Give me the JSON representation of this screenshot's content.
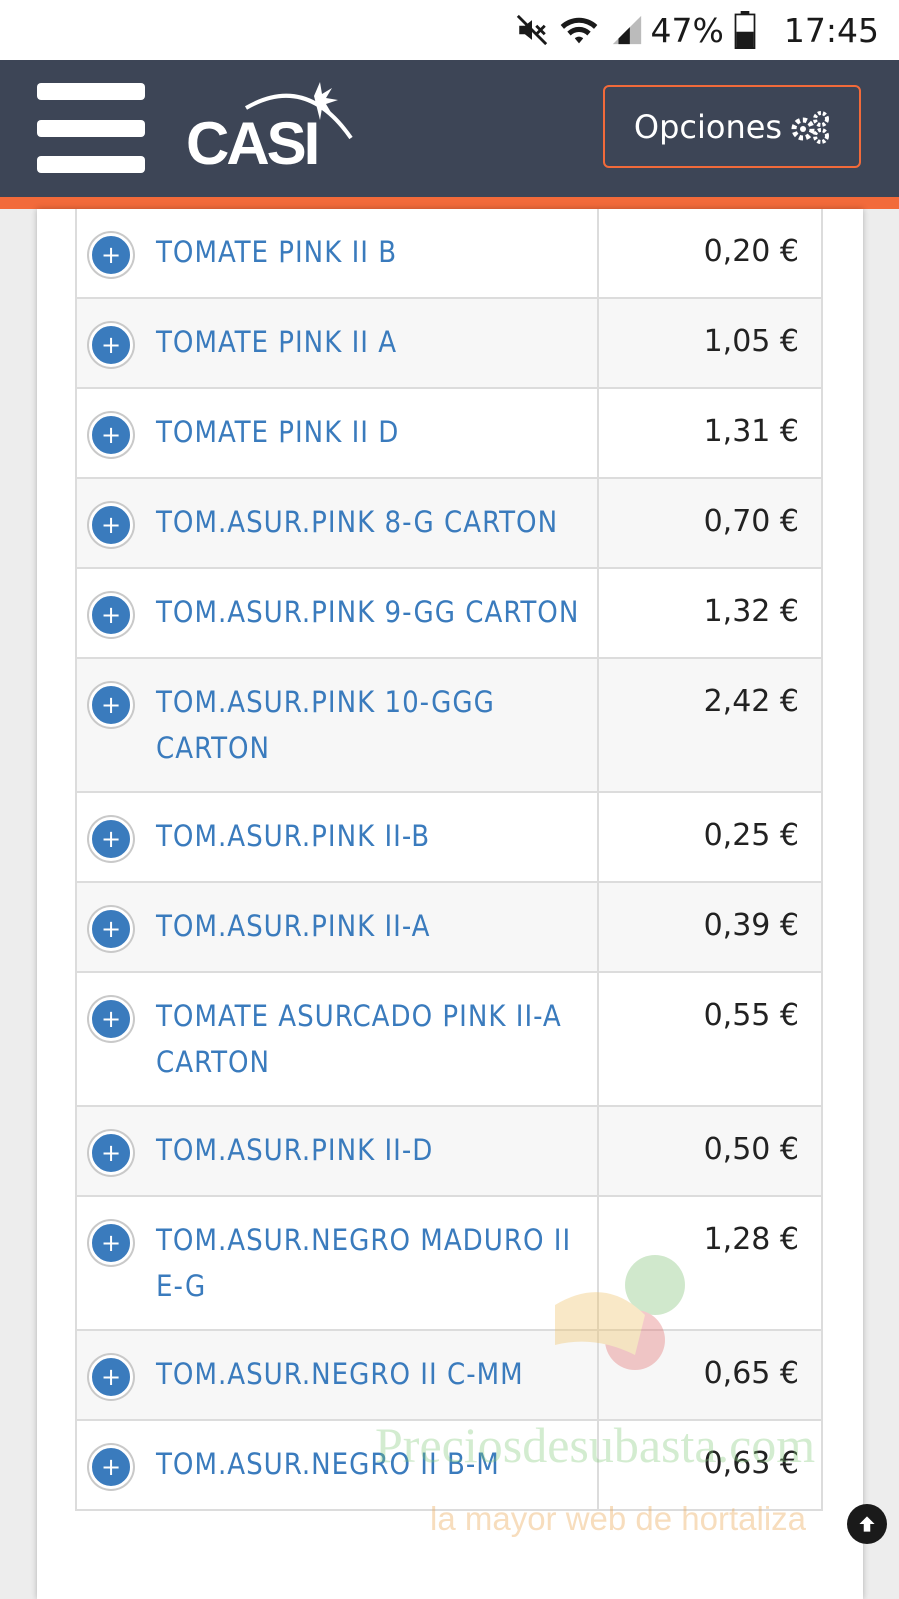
{
  "status_bar": {
    "battery": "47%",
    "time": "17:45",
    "icons": [
      "mute-icon",
      "wifi-icon",
      "signal-icon",
      "battery-icon"
    ]
  },
  "header": {
    "logo_text": "CASI",
    "options_label": "Opciones",
    "options_icon": "gears-icon",
    "colors": {
      "bar": "#3d4556",
      "accent": "#f26a3a"
    }
  },
  "products": [
    {
      "name": "TOMATE PINK II B",
      "price": "0,20 €"
    },
    {
      "name": "TOMATE PINK II A",
      "price": "1,05 €"
    },
    {
      "name": "TOMATE PINK II D",
      "price": "1,31 €"
    },
    {
      "name": "TOM.ASUR.PINK 8-G CARTON",
      "price": "0,70 €"
    },
    {
      "name": "TOM.ASUR.PINK 9-GG CARTON",
      "price": "1,32 €"
    },
    {
      "name": "TOM.ASUR.PINK 10-GGG CARTON",
      "price": "2,42 €"
    },
    {
      "name": "TOM.ASUR.PINK II-B",
      "price": "0,25 €"
    },
    {
      "name": "TOM.ASUR.PINK II-A",
      "price": "0,39 €"
    },
    {
      "name": "TOMATE ASURCADO PINK II-A CARTON",
      "price": "0,55 €"
    },
    {
      "name": "TOM.ASUR.PINK II-D",
      "price": "0,50 €"
    },
    {
      "name": "TOM.ASUR.NEGRO MADURO II E-G",
      "price": "1,28 €"
    },
    {
      "name": "TOM.ASUR.NEGRO II C-MM",
      "price": "0,65 €"
    },
    {
      "name": "TOM.ASUR.NEGRO II B-M",
      "price": "0,63 €"
    }
  ],
  "watermark": {
    "site": "Preciosdesubasta.com",
    "tagline": "la mayor web de hortaliza"
  },
  "scroll_top_icon": "arrow-up-circle-icon"
}
